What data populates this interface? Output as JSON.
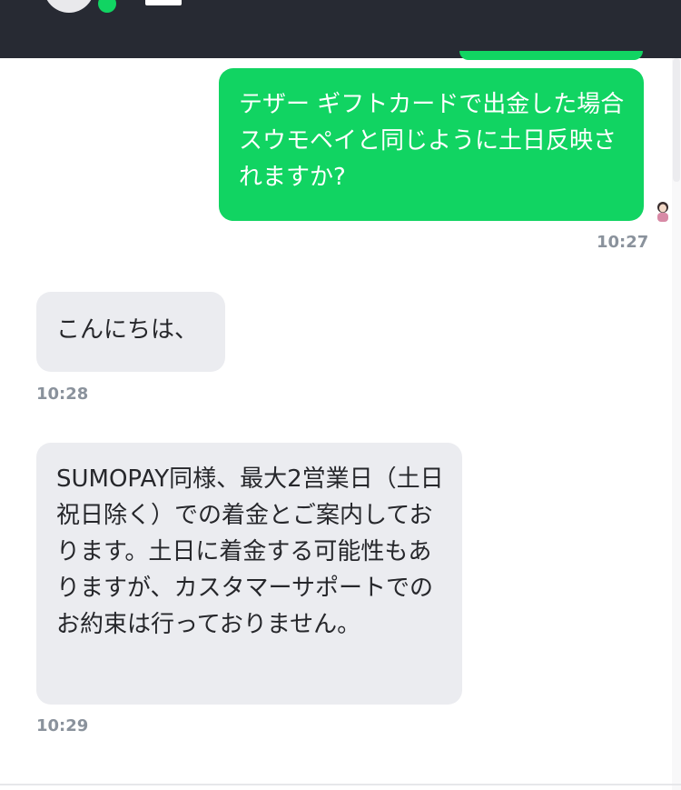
{
  "messages": [
    {
      "direction": "outgoing",
      "text": "テザー ギフトカードで出金した場合スウモペイと同じように土日反映されますか?",
      "time": "10:27"
    },
    {
      "direction": "incoming",
      "text": "こんにちは、",
      "time": "10:28"
    },
    {
      "direction": "incoming",
      "text": "SUMOPAY同様、最大2営業日（土日祝日除く）での着金とご案内しております。土日に着金する可能性もありますが、カスタマーサポートでのお約束は行っておりません。",
      "time": "10:29"
    }
  ],
  "colors": {
    "header_bg": "#272a33",
    "outgoing_bubble": "#11d462",
    "incoming_bubble": "#ebecf0",
    "time_text": "#8a929c",
    "online_status": "#11d462"
  },
  "icons": {
    "agent_avatar": "agent-avatar-icon",
    "online_status": "online-status-dot",
    "language_flag": "japan-flag-icon",
    "read_receipt": "read-receipt-avatar-icon"
  }
}
